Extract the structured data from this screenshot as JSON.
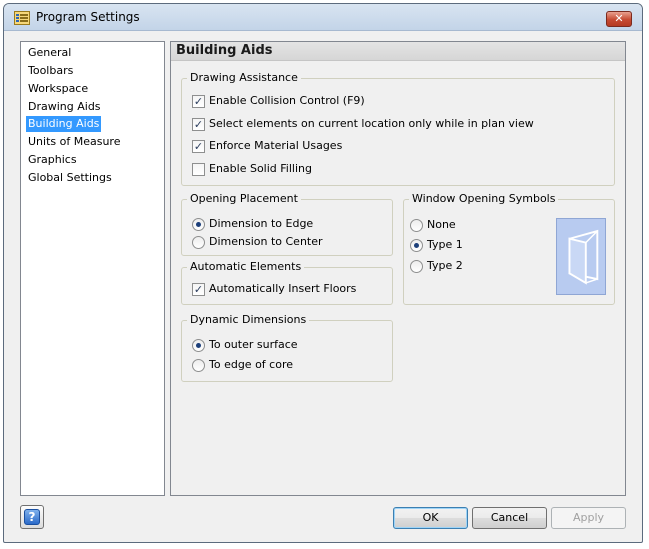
{
  "window": {
    "title": "Program Settings",
    "close_glyph": "✕",
    "app_icon": "settings-app-icon"
  },
  "nav": {
    "items": [
      {
        "label": "General",
        "selected": false
      },
      {
        "label": "Toolbars",
        "selected": false
      },
      {
        "label": "Workspace",
        "selected": false
      },
      {
        "label": "Drawing Aids",
        "selected": false
      },
      {
        "label": "Building Aids",
        "selected": true
      },
      {
        "label": "Units of Measure",
        "selected": false
      },
      {
        "label": "Graphics",
        "selected": false
      },
      {
        "label": "Global Settings",
        "selected": false
      }
    ]
  },
  "panel": {
    "title": "Building Aids",
    "drawing_assistance": {
      "legend": "Drawing Assistance",
      "options": [
        {
          "label": "Enable Collision Control (F9)",
          "checked": true
        },
        {
          "label": "Select elements on current location only while in plan view",
          "checked": true
        },
        {
          "label": "Enforce Material Usages",
          "checked": true
        },
        {
          "label": "Enable Solid Filling",
          "checked": false
        }
      ]
    },
    "opening_placement": {
      "legend": "Opening Placement",
      "options": [
        {
          "label": "Dimension to Edge",
          "selected": true
        },
        {
          "label": "Dimension to Center",
          "selected": false
        }
      ]
    },
    "window_symbols": {
      "legend": "Window Opening Symbols",
      "options": [
        {
          "label": "None",
          "selected": false
        },
        {
          "label": "Type 1",
          "selected": true
        },
        {
          "label": "Type 2",
          "selected": false
        }
      ]
    },
    "automatic_elements": {
      "legend": "Automatic Elements",
      "options": [
        {
          "label": "Automatically Insert Floors",
          "checked": true
        }
      ]
    },
    "dynamic_dimensions": {
      "legend": "Dynamic Dimensions",
      "options": [
        {
          "label": "To outer surface",
          "selected": true
        },
        {
          "label": "To edge of core",
          "selected": false
        }
      ]
    }
  },
  "footer": {
    "help_label": "?",
    "ok_label": "OK",
    "cancel_label": "Cancel",
    "apply_label": "Apply"
  },
  "colors": {
    "selection": "#3399ff",
    "preview_fill": "#b8cbf0"
  }
}
